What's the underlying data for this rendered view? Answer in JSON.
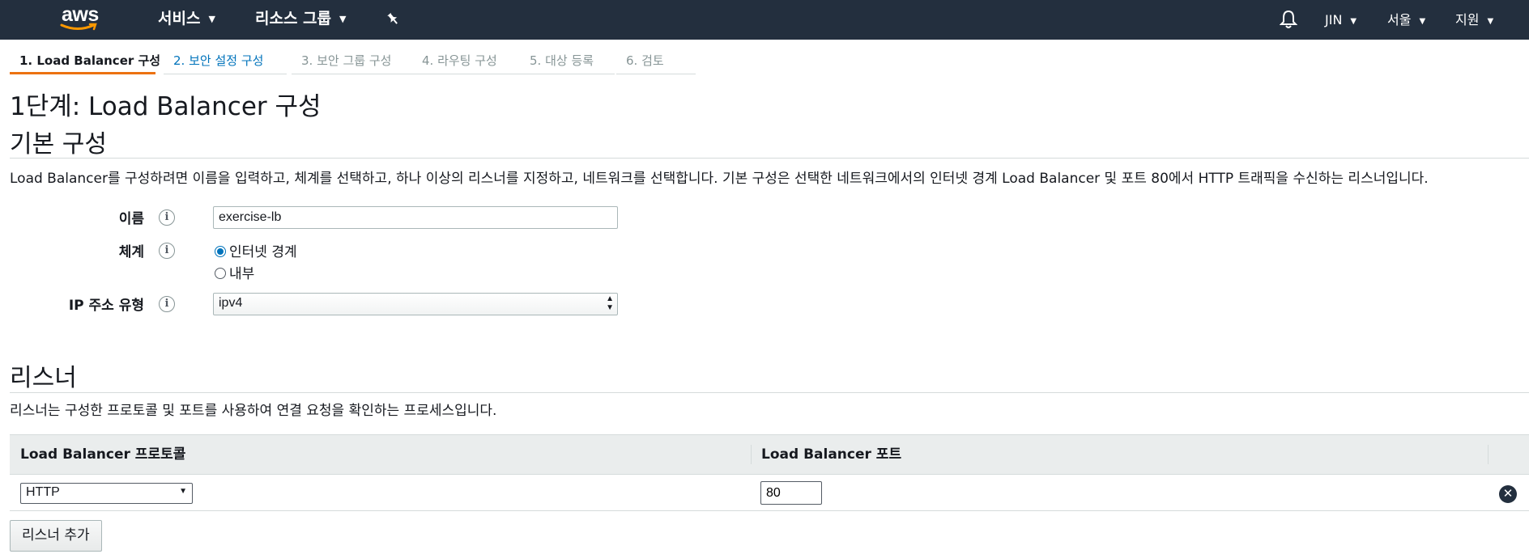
{
  "topnav": {
    "logo_text": "aws",
    "services": "서비스",
    "resource_groups": "리소스 그룹",
    "pin_icon": "pin-icon",
    "bell_icon": "bell-icon",
    "user": "JIN",
    "region": "서울",
    "support": "지원",
    "colors": {
      "bar": "#232f3e",
      "smile": "#ff9900"
    }
  },
  "tabs": [
    {
      "label": "1. Load Balancer 구성",
      "state": "active"
    },
    {
      "label": "2. 보안 설정 구성",
      "state": "link"
    },
    {
      "label": "3. 보안 그룹 구성",
      "state": "disabled"
    },
    {
      "label": "4. 라우팅 구성",
      "state": "disabled"
    },
    {
      "label": "5. 대상 등록",
      "state": "disabled"
    },
    {
      "label": "6. 검토",
      "state": "disabled"
    }
  ],
  "page_title": "1단계: Load Balancer 구성",
  "basic": {
    "heading": "기본 구성",
    "description": "Load Balancer를 구성하려면 이름을 입력하고, 체계를 선택하고, 하나 이상의 리스너를 지정하고, 네트워크를 선택합니다. 기본 구성은 선택한 네트워크에서의 인터넷 경계 Load Balancer 및 포트 80에서 HTTP 트래픽을 수신하는 리스너입니다.",
    "name_label": "이름",
    "name_value": "exercise-lb",
    "scheme_label": "체계",
    "scheme_options": [
      "인터넷 경계",
      "내부"
    ],
    "scheme_selected": "인터넷 경계",
    "ip_label": "IP 주소 유형",
    "ip_value": "ipv4",
    "info_glyph": "i"
  },
  "listeners": {
    "heading": "리스너",
    "description": "리스너는 구성한 프로토콜 및 포트를 사용하여 연결 요청을 확인하는 프로세스입니다.",
    "col_protocol": "Load Balancer 프로토콜",
    "col_port": "Load Balancer 포트",
    "rows": [
      {
        "protocol": "HTTP",
        "port": "80"
      }
    ],
    "add_button": "리스너 추가",
    "remove_glyph": "✕"
  }
}
